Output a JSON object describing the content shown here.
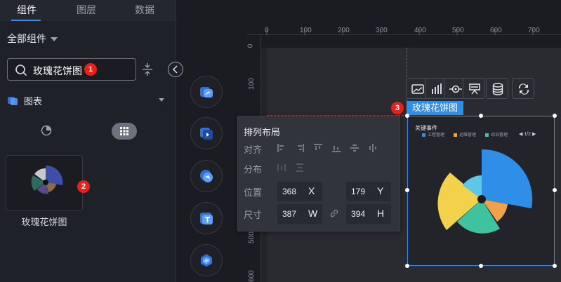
{
  "tabs": [
    {
      "label": "组件",
      "active": true
    },
    {
      "label": "图层",
      "active": false
    },
    {
      "label": "数据",
      "active": false
    }
  ],
  "all_components_label": "全部组件",
  "search": {
    "value": "玫瑰花饼图",
    "badge": "1"
  },
  "category": {
    "label": "图表"
  },
  "component_card": {
    "label": "玫瑰花饼图",
    "badge": "2"
  },
  "ruler": {
    "top": [
      "0",
      "100",
      "200",
      "300",
      "400",
      "500",
      "600",
      "700"
    ],
    "left": [
      "0",
      "100",
      "500",
      "600"
    ]
  },
  "layout_panel": {
    "title": "排列布局",
    "align_label": "对齐",
    "distribute_label": "分布",
    "position_label": "位置",
    "size_label": "尺寸",
    "x_value": "368",
    "x_unit": "X",
    "y_value": "179",
    "y_unit": "Y",
    "w_value": "387",
    "w_unit": "W",
    "h_value": "394",
    "h_unit": "H"
  },
  "selected_tag": {
    "badge": "3",
    "label": "玫瑰花饼图"
  },
  "widget": {
    "title": "关键事件",
    "legend": [
      {
        "label": "工程管理",
        "color": "#2f8fe8"
      },
      {
        "label": "运维管理",
        "color": "#f0a14a"
      },
      {
        "label": "综治管理",
        "color": "#3fc2a0"
      }
    ],
    "pager": "1/2"
  },
  "colors": {
    "accent": "#2f8fe8",
    "badge_red": "#e8201a",
    "guide_red": "#c03a2e"
  }
}
